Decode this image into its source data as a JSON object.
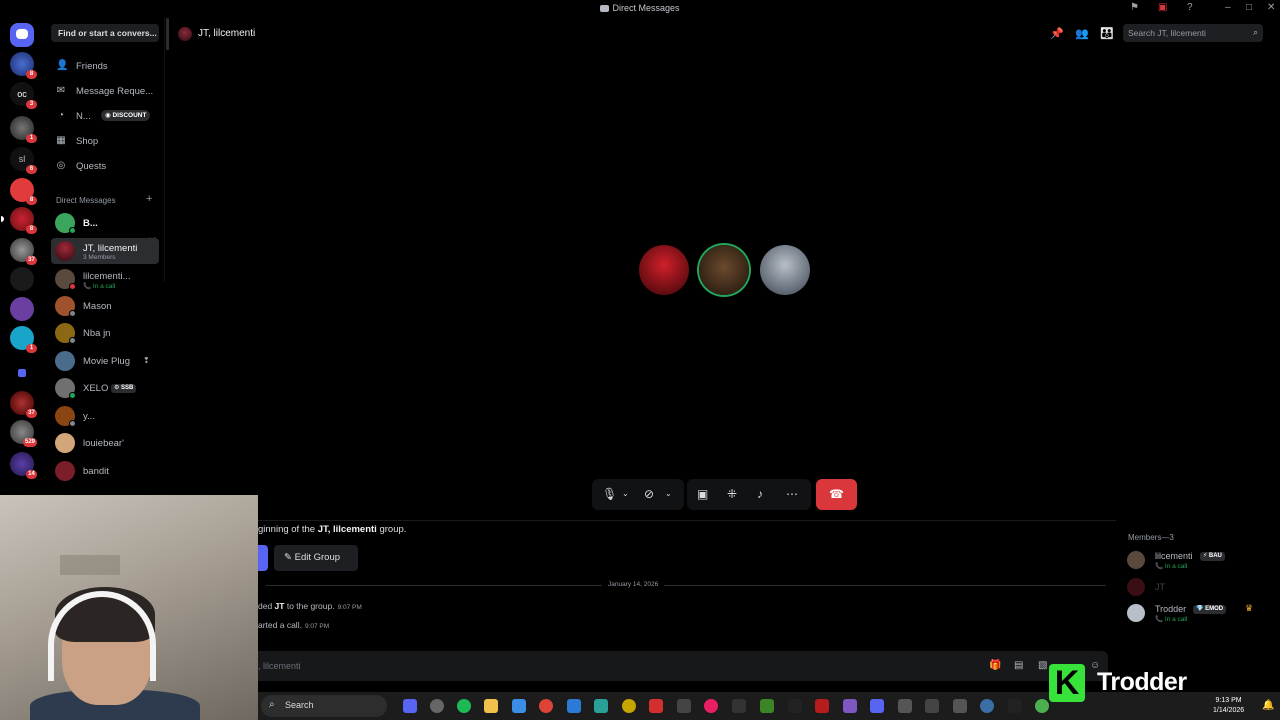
{
  "window": {
    "title": "Direct Messages"
  },
  "sidebar": {
    "find_placeholder": "Find or start a convers...",
    "nav": [
      {
        "label": "Friends",
        "icon": "friends-icon"
      },
      {
        "label": "Message Reque...",
        "icon": "envelope-icon"
      },
      {
        "label": "N...",
        "icon": "nitro-icon",
        "badge": "DISCOUNT"
      },
      {
        "label": "Shop",
        "icon": "shop-icon"
      },
      {
        "label": "Quests",
        "icon": "quests-icon"
      }
    ],
    "dm_header": "Direct Messages",
    "dms": [
      {
        "name": "B...",
        "online": true,
        "avatar_color": "#3ba55d"
      },
      {
        "name": "JT, lilcementi",
        "sub": "3 Members",
        "selected": true,
        "avatar_color": "#6b1a22"
      },
      {
        "name": "lilcementi...",
        "sub": "In a call",
        "avatar_color": "#5a4a3e"
      },
      {
        "name": "Mason",
        "avatar_color": "#a0522d"
      },
      {
        "name": "Nba jn",
        "avatar_color": "#8b6914"
      },
      {
        "name": "Movie Plug",
        "avatar_color": "#4a6b8a"
      },
      {
        "name": "XELO",
        "tag": "SSB",
        "online": true,
        "avatar_color": "#707070"
      },
      {
        "name": "y...",
        "avatar_color": "#8b4513"
      },
      {
        "name": "louiebear'",
        "avatar_color": "#d2a679"
      },
      {
        "name": "bandit",
        "avatar_color": "#7a1e2a"
      }
    ]
  },
  "rail": {
    "badges": [
      "8",
      "3",
      "1",
      "6",
      "8",
      "8",
      "37",
      "1",
      "37",
      "529",
      "14"
    ]
  },
  "header": {
    "channel": "JT, lilcementi",
    "search_placeholder": "Search JT, lilcementi"
  },
  "chat": {
    "intro_prefix": "ginning of the ",
    "intro_group": "JT, lilcementi",
    "intro_suffix": " group.",
    "edit_group": "Edit Group",
    "date": "January 14, 2026",
    "msg1_prefix": "ded ",
    "msg1_name": "JT",
    "msg1_suffix": " to the group.",
    "msg1_time": "9:07 PM",
    "msg2_text": "arted a call.",
    "msg2_time": "9:07 PM",
    "composer_placeholder": ", lilcementi"
  },
  "members": {
    "header": "Members—3",
    "list": [
      {
        "name": "lilcementi",
        "tag": "BAU",
        "sub": "In a call"
      },
      {
        "name": "JT",
        "sub": ""
      },
      {
        "name": "Trodder",
        "tag": "EMOD",
        "sub": "In a call"
      }
    ]
  },
  "taskbar": {
    "search": "Search",
    "time": "9:13 PM",
    "date": "1/14/2026"
  },
  "watermark": {
    "letter": "K",
    "text": "Trodder"
  },
  "colors": {
    "hangup": "#da373c",
    "online": "#23a55a",
    "blurple": "#5865f2",
    "brand_green": "#37e23a"
  }
}
